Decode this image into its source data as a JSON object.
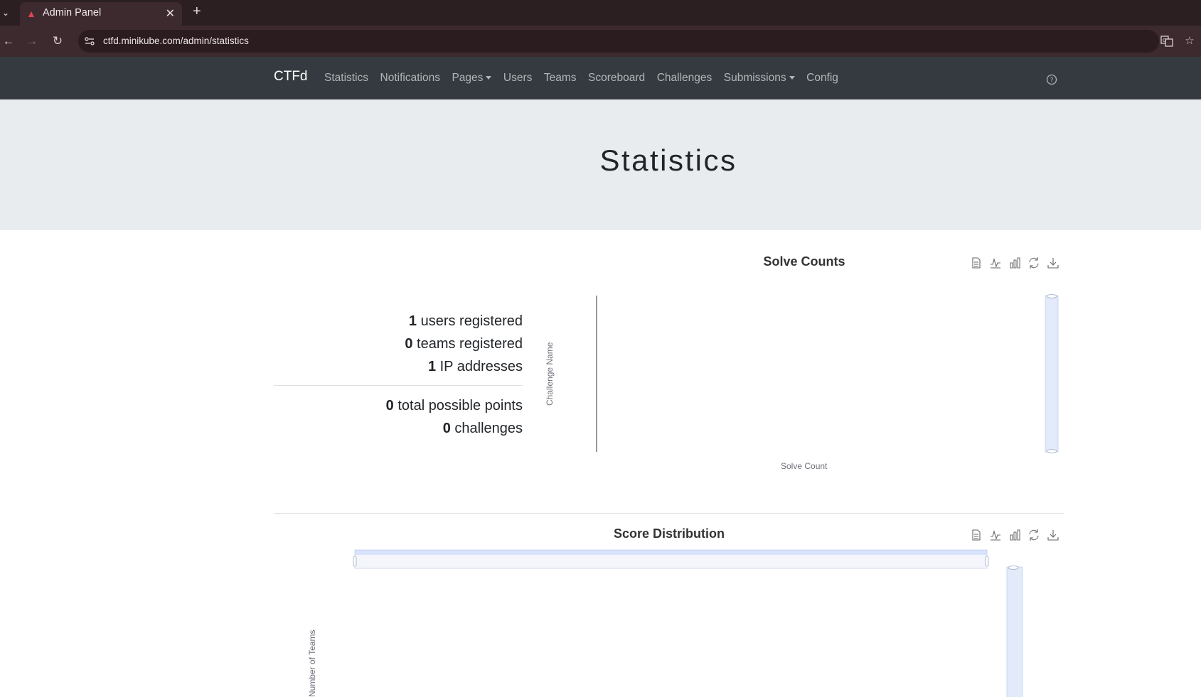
{
  "browser": {
    "tab_title": "Admin Panel",
    "url": "ctfd.minikube.com/admin/statistics",
    "icons": [
      "tab-list-icon",
      "close-icon",
      "plus-icon",
      "back-icon",
      "forward-icon",
      "reload-icon",
      "site-settings-icon",
      "translate-icon",
      "star-icon"
    ]
  },
  "navbar": {
    "brand": "CTFd",
    "items": [
      "Statistics",
      "Notifications",
      "Pages",
      "Users",
      "Teams",
      "Scoreboard",
      "Challenges",
      "Submissions",
      "Config"
    ],
    "dropdown_items": [
      "Pages",
      "Submissions"
    ],
    "help_icon": "question-circle-icon"
  },
  "page": {
    "title": "Statistics"
  },
  "stats": {
    "users": {
      "value": "1",
      "label": "users registered"
    },
    "teams": {
      "value": "0",
      "label": "teams registered"
    },
    "ips": {
      "value": "1",
      "label": "IP addresses"
    },
    "points": {
      "value": "0",
      "label": "total possible points"
    },
    "challenges": {
      "value": "0",
      "label": "challenges"
    }
  },
  "toolbox_icons": [
    "data-view-icon",
    "line-chart-icon",
    "bar-chart-icon",
    "restore-icon",
    "download-icon"
  ],
  "chart_data": [
    {
      "type": "bar",
      "title": "Solve Counts",
      "xlabel": "Solve Count",
      "ylabel": "Challenge Name",
      "categories": [],
      "values": [],
      "has_datazoom": true
    },
    {
      "type": "bar",
      "title": "Score Distribution",
      "xlabel": "",
      "ylabel": "Number of Teams",
      "categories": [],
      "values": [],
      "has_datazoom": true
    }
  ],
  "colors": {
    "navbar_bg": "#343a40",
    "jumbotron_bg": "#e9ecef",
    "browser_bg": "#3c2a2e"
  }
}
